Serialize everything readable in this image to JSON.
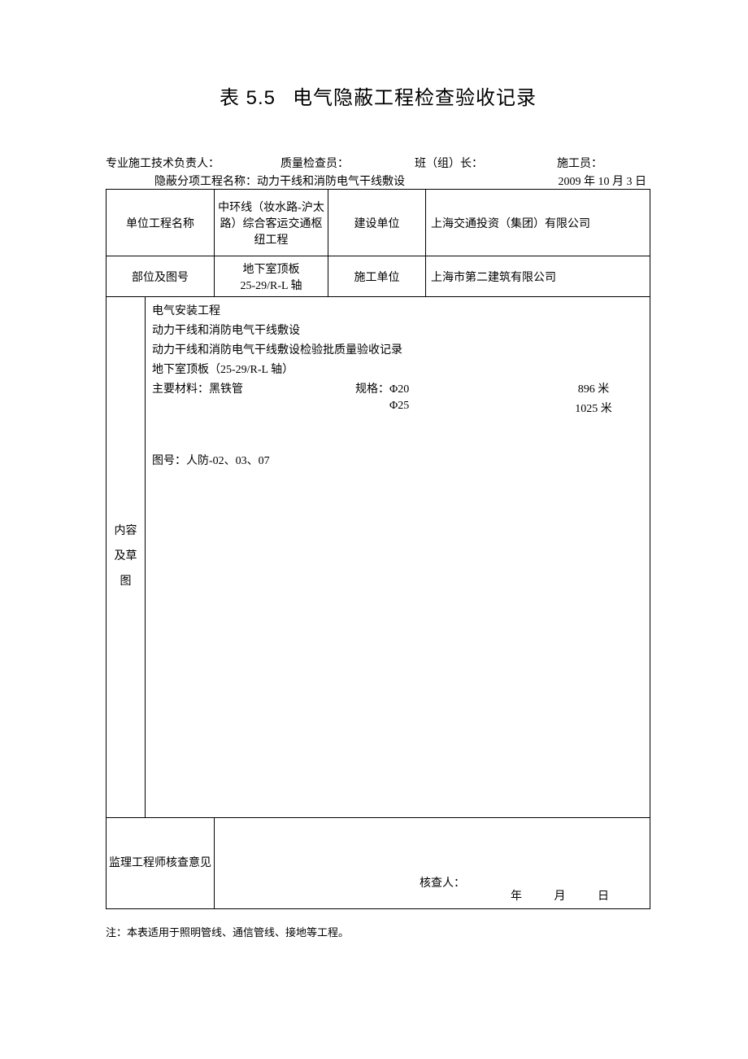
{
  "title_prefix": "表 5.5",
  "title_main": "电气隐蔽工程检查验收记录",
  "header": {
    "tech_lead_label": "专业施工技术负责人：",
    "qc_label": "质量检查员：",
    "team_lead_label": "班（组）长：",
    "worker_label": "施工员：",
    "sub_name_label": "隐蔽分项工程名称：",
    "sub_name_value": "动力干线和消防电气干线敷设",
    "date": "2009 年 10 月 3 日"
  },
  "row1": {
    "unit_label": "单位工程名称",
    "unit_value": "中环线（妆水路-沪太路）综合客运交通枢纽工程",
    "build_unit_label": "建设单位",
    "build_unit_value": "上海交通投资（集团）有限公司"
  },
  "row2": {
    "part_label": "部位及图号",
    "part_value": "地下室顶板\n25-29/R-L 轴",
    "construct_label": "施工单位",
    "construct_value": "上海市第二建筑有限公司"
  },
  "content": {
    "side_label_1": "内容",
    "side_label_2": "及草",
    "side_label_3": "图",
    "l1": "电气安装工程",
    "l2": "动力干线和消防电气干线敷设",
    "l3": "动力干线和消防电气干线敷设检验批质量验收记录",
    "l4": "地下室顶板（25-29/R-L 轴）",
    "mat_label": "主要材料：黑铁管",
    "spec_label": "规格：",
    "spec1": "Φ20",
    "qty1": "896 米",
    "spec2": "Φ25",
    "qty2": "1025 米",
    "drawing": "图号：人防-02、03、07"
  },
  "footer": {
    "opinion_label": "监理工程师核查意见",
    "reviewer_label": "核查人：",
    "y": "年",
    "m": "月",
    "d": "日"
  },
  "note": "注：本表适用于照明管线、通信管线、接地等工程。"
}
